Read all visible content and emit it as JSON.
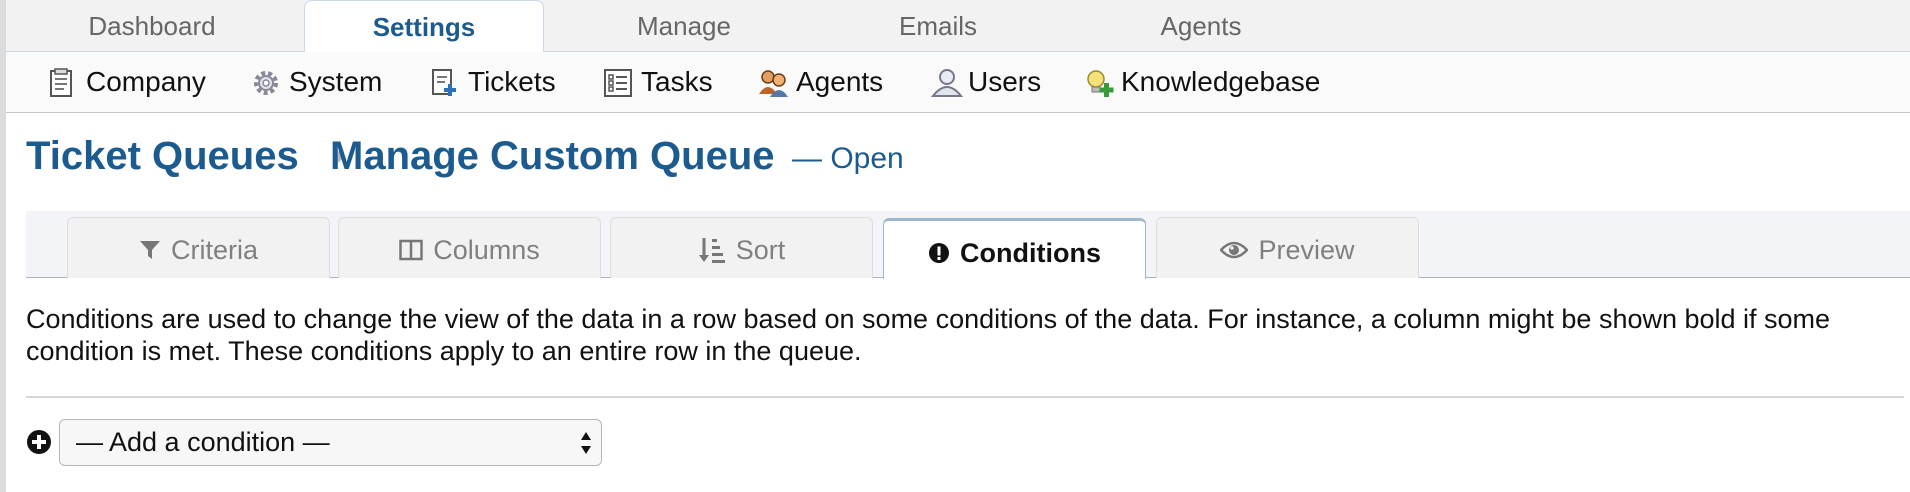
{
  "top_nav": {
    "tabs": [
      {
        "label": "Dashboard"
      },
      {
        "label": "Settings",
        "active": true
      },
      {
        "label": "Manage"
      },
      {
        "label": "Emails"
      },
      {
        "label": "Agents"
      }
    ]
  },
  "sub_nav": {
    "items": [
      {
        "label": "Company",
        "icon": "company-icon"
      },
      {
        "label": "System",
        "icon": "gear-icon"
      },
      {
        "label": "Tickets",
        "icon": "tickets-icon"
      },
      {
        "label": "Tasks",
        "icon": "tasks-icon"
      },
      {
        "label": "Agents",
        "icon": "agents-icon"
      },
      {
        "label": "Users",
        "icon": "users-icon"
      },
      {
        "label": "Knowledgebase",
        "icon": "knowledgebase-icon"
      }
    ]
  },
  "page": {
    "breadcrumb_root": "Ticket Queues",
    "title": "Manage Custom Queue",
    "status": "— Open"
  },
  "queue_tabs": [
    {
      "label": "Criteria",
      "icon": "filter-icon"
    },
    {
      "label": "Columns",
      "icon": "columns-icon"
    },
    {
      "label": "Sort",
      "icon": "sort-icon"
    },
    {
      "label": "Conditions",
      "icon": "exclamation-icon",
      "active": true
    },
    {
      "label": "Preview",
      "icon": "eye-icon"
    }
  ],
  "conditions": {
    "description": "Conditions are used to change the view of the data in a row based on some conditions of the data. For instance, a column might be shown bold if some condition is met. These conditions apply to an entire row in the queue.",
    "add_select_value": "— Add a condition —"
  },
  "colors": {
    "accent": "#1c5b8f",
    "nav_bg": "#f2f2f2",
    "tab_border": "#9fb6cc"
  }
}
